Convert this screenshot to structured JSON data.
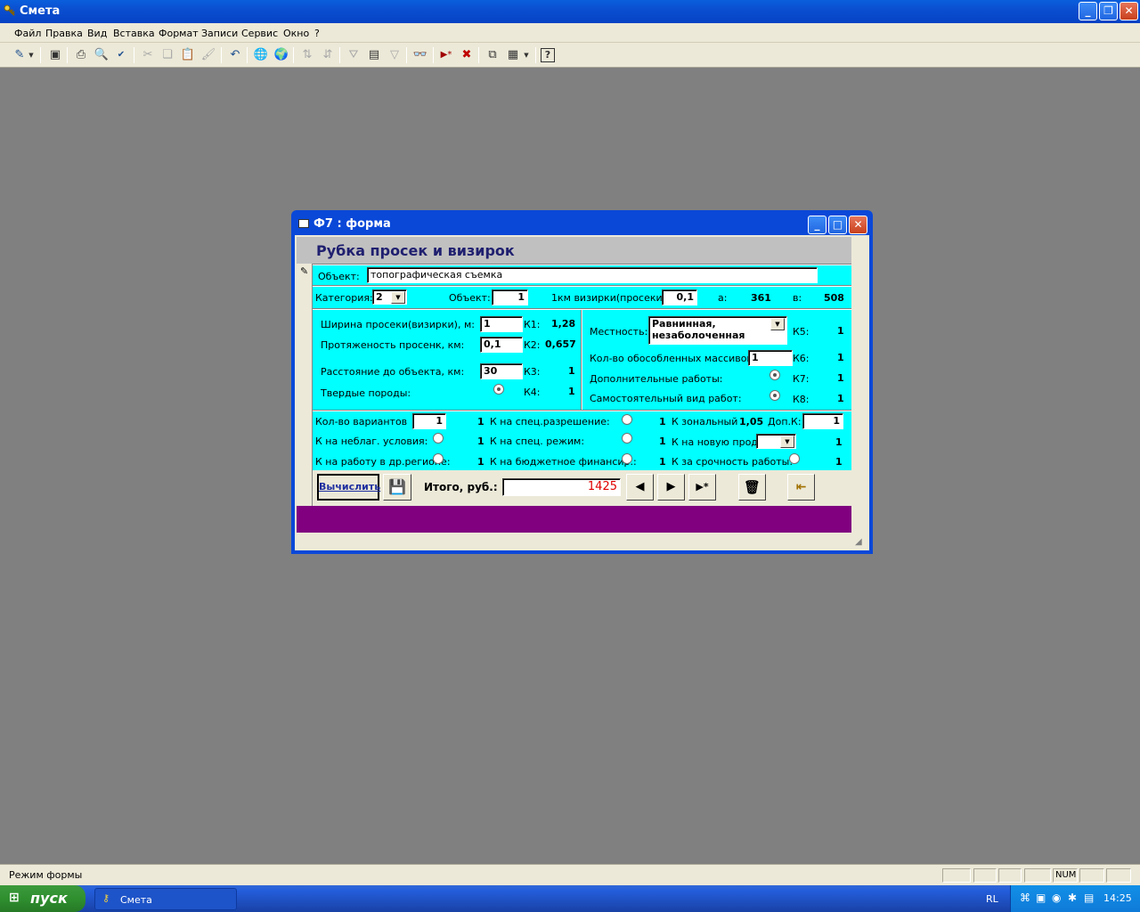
{
  "app": {
    "title": "Смета",
    "menu": [
      "Файл",
      "Правка",
      "Вид",
      "Вставка",
      "Формат",
      "Записи",
      "Сервис",
      "Окно",
      "?"
    ]
  },
  "toolbar_icons": [
    "view-icon",
    "save-icon",
    "print-icon",
    "print-preview-icon",
    "spelling-icon",
    "cut-icon",
    "copy-icon",
    "paste-icon",
    "format-painter-icon",
    "undo-icon",
    "hyperlink-icon",
    "web-icon",
    "sort-asc-icon",
    "sort-desc-icon",
    "filter-selection-icon",
    "filter-form-icon",
    "apply-filter-icon",
    "find-icon",
    "new-record-icon",
    "delete-record-icon",
    "database-window-icon",
    "new-object-icon",
    "help-icon"
  ],
  "form": {
    "window_title": "Ф7 : форма",
    "heading": "Рубка просек и визирок",
    "object_label": "Объект:",
    "object_value": "топографическая съемка",
    "category_label": "Категория:",
    "category_value": "2",
    "object2_label": "Объект:",
    "object2_value": "1",
    "km_label": "1км визирки(просеки):",
    "km_value": "0,1",
    "a_label": "а:",
    "a_value": "361",
    "b_label": "в:",
    "b_value": "508",
    "left": {
      "width_label": "Ширина просеки(визирки), м:",
      "width_value": "1",
      "k1_label": "К1:",
      "k1_value": "1,28",
      "length_label": "Протяженость просенк, км:",
      "length_value": "0,1",
      "k2_label": "К2:",
      "k2_value": "0,657",
      "distance_label": "Расстояние до объекта, км:",
      "distance_value": "30",
      "k3_label": "К3:",
      "k3_value": "1",
      "rocks_label": "Твердые породы:",
      "k4_label": "К4:",
      "k4_value": "1"
    },
    "right": {
      "terrain_label": "Местность:",
      "terrain_value_1": "Равнинная,",
      "terrain_value_2": "незаболоченная",
      "k5_label": "К5:",
      "k5_value": "1",
      "massifs_label": "Кол-во обособленных массивов",
      "massifs_value": "1",
      "k6_label": "К6:",
      "k6_value": "1",
      "extra_label": "Дополнительные работы:",
      "k7_label": "К7:",
      "k7_value": "1",
      "independent_label": "Самостоятельный вид работ:",
      "k8_label": "К8:",
      "k8_value": "1"
    },
    "bottom": {
      "variants_label": "Кол-во вариантов",
      "variants_value": "1",
      "variants_k": "1",
      "unfav_label": "К на неблаг. условия:",
      "unfav_k": "1",
      "region_label": "К на работу в др.регионе:",
      "region_k": "1",
      "special_perm_label": "К на спец.разрешение:",
      "special_perm_k": "1",
      "special_mode_label": "К на спец. режим:",
      "special_mode_k": "1",
      "budget_label": "К на бюджетное финансир.:",
      "budget_k": "1",
      "zonal_label": "К зональный",
      "zonal_value": "1,05",
      "dop_label": "Доп.К:",
      "dop_value": "1",
      "newprod_label": "К на новую прод.:",
      "newprod_k": "1",
      "urgency_label": "К за срочность работы:",
      "urgency_k": "1"
    },
    "calc_button": "Вычислить",
    "total_label": "Итого, руб.:",
    "total_value": "1425"
  },
  "status": {
    "mode": "Режим формы",
    "num": "NUM"
  },
  "taskbar": {
    "start": "пуск",
    "task": "Смета",
    "lang": "RL",
    "time": "14:25"
  }
}
